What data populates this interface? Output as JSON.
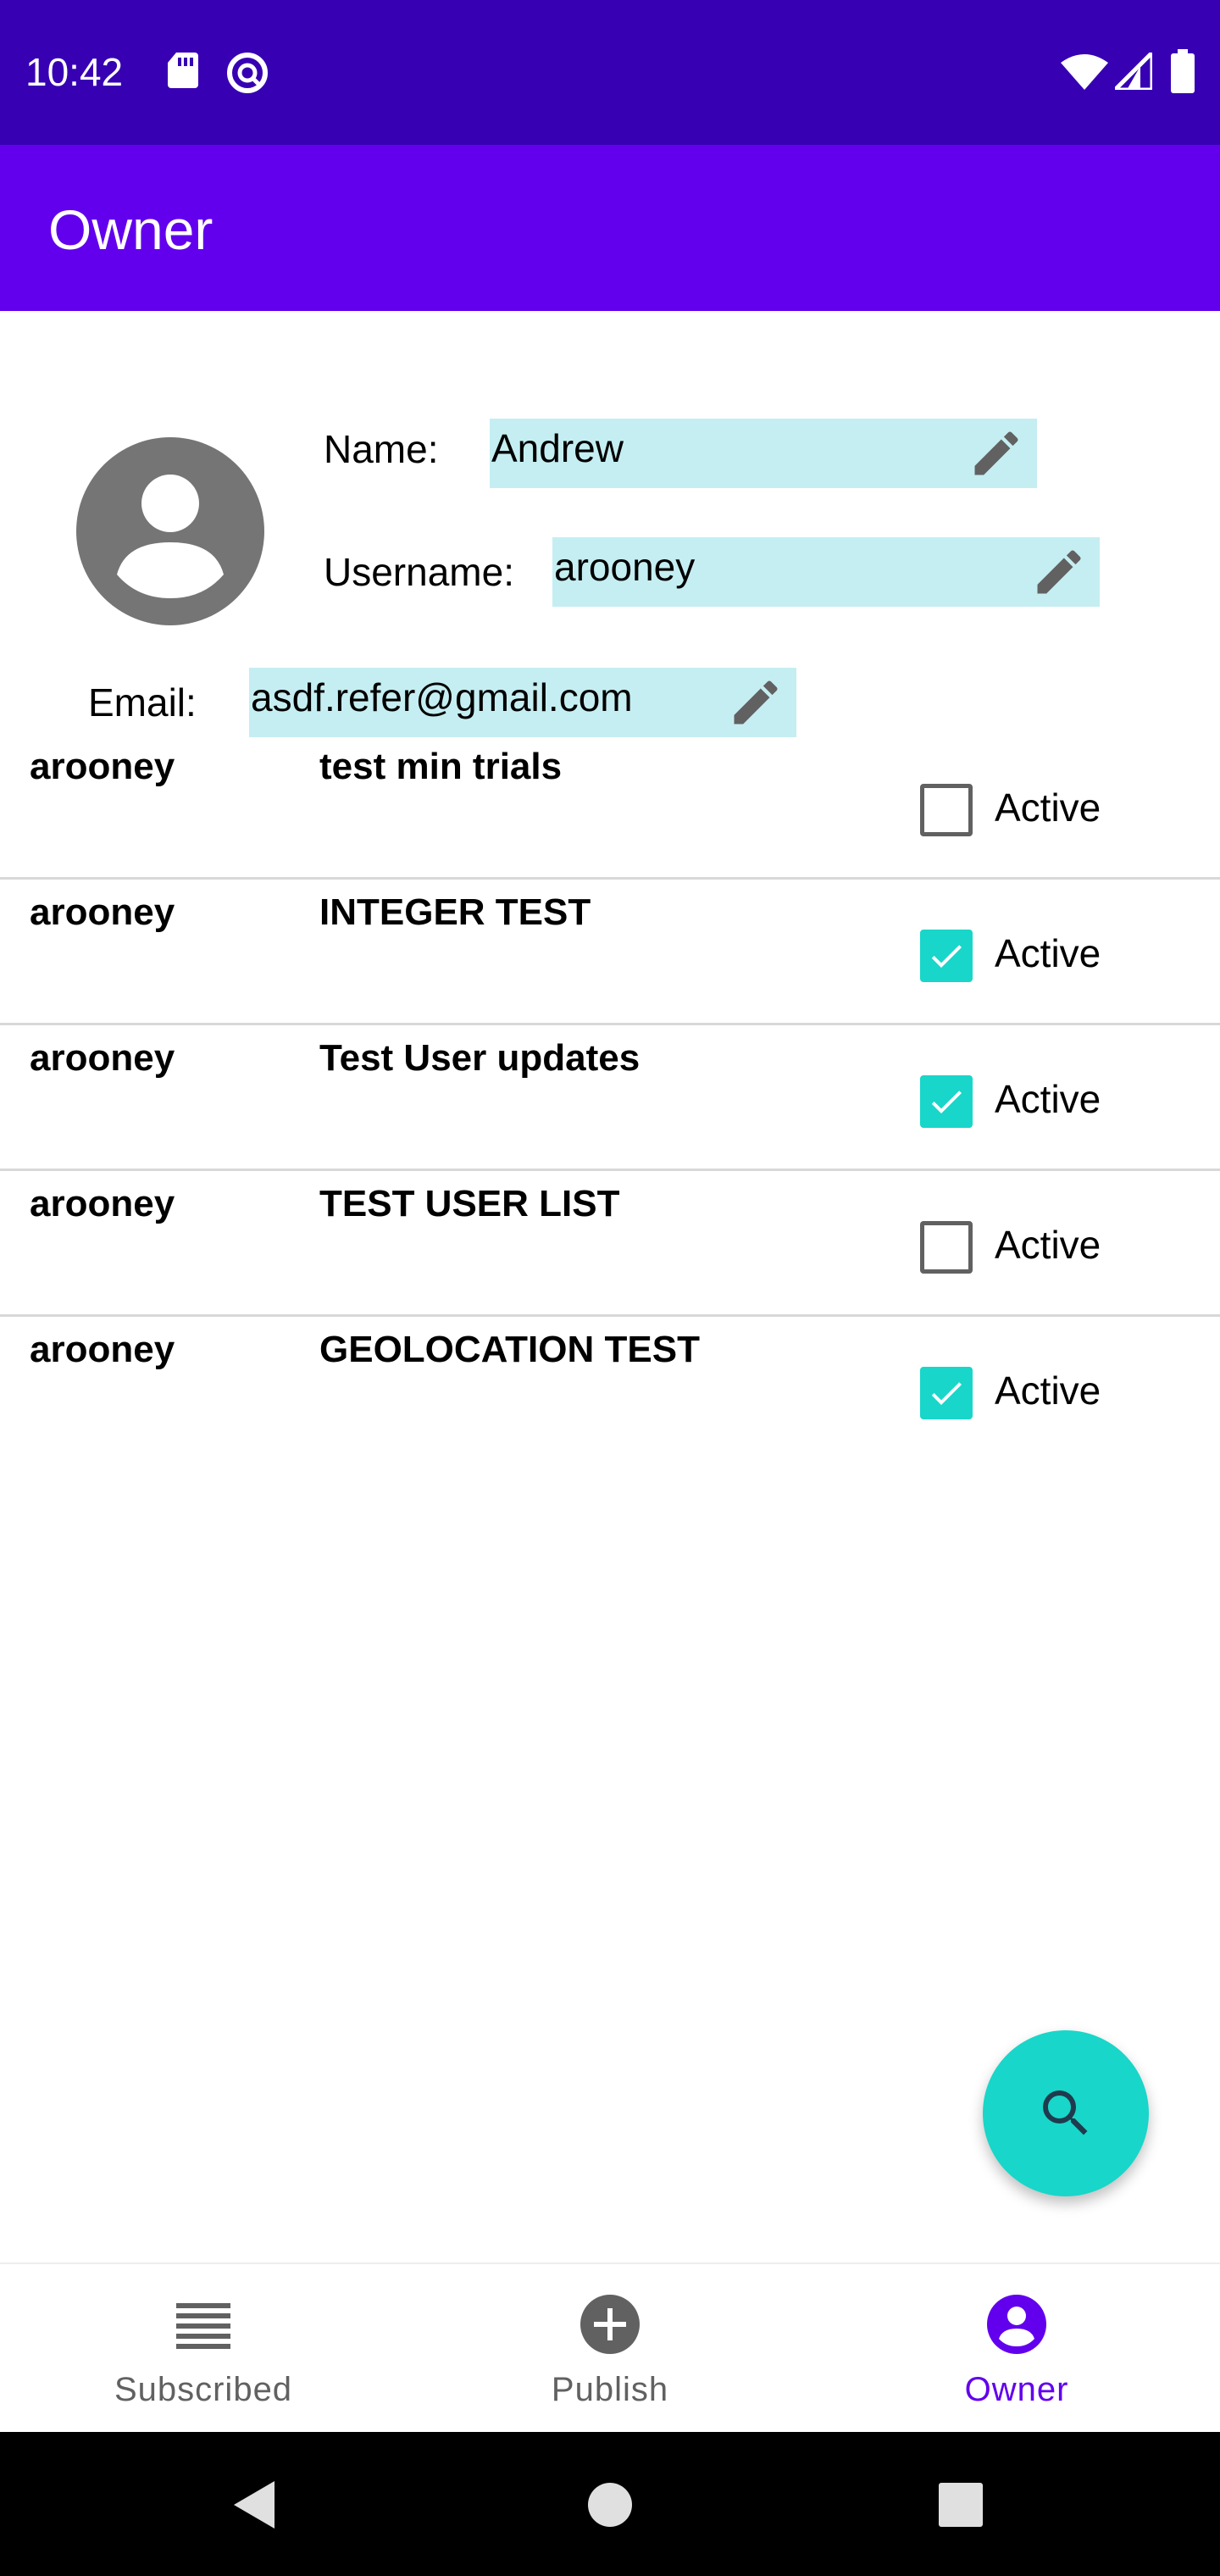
{
  "status_bar": {
    "time": "10:42",
    "icons_left": [
      "sd-card-icon",
      "sync-icon"
    ],
    "icons_right": [
      "wifi-icon",
      "signal-icon",
      "battery-icon"
    ]
  },
  "app_bar": {
    "title": "Owner"
  },
  "profile": {
    "avatar_icon": "account-circle-icon",
    "name_label": "Name:",
    "name_value": "Andrew",
    "username_label": "Username:",
    "username_value": "arooney",
    "email_label": "Email:",
    "email_value": "asdf.refer@gmail.com"
  },
  "experiments": [
    {
      "owner": "arooney",
      "title": "test min trials",
      "active": false,
      "active_label": "Active"
    },
    {
      "owner": "arooney",
      "title": "INTEGER TEST",
      "active": true,
      "active_label": "Active"
    },
    {
      "owner": "arooney",
      "title": "Test User updates",
      "active": true,
      "active_label": "Active"
    },
    {
      "owner": "arooney",
      "title": "TEST USER LIST",
      "active": false,
      "active_label": "Active"
    },
    {
      "owner": "arooney",
      "title": "GEOLOCATION TEST",
      "active": true,
      "active_label": "Active"
    }
  ],
  "fab": {
    "icon": "search-icon"
  },
  "bottom_nav": {
    "items": [
      {
        "label": "Subscribed",
        "icon": "list-icon",
        "active": false
      },
      {
        "label": "Publish",
        "icon": "add-circle-icon",
        "active": false
      },
      {
        "label": "Owner",
        "icon": "account-circle-icon",
        "active": true
      }
    ]
  },
  "colors": {
    "status_bar": "#3700B3",
    "app_bar": "#6200EE",
    "accent": "#18D6C9",
    "field_bg": "#C5EEF2"
  }
}
